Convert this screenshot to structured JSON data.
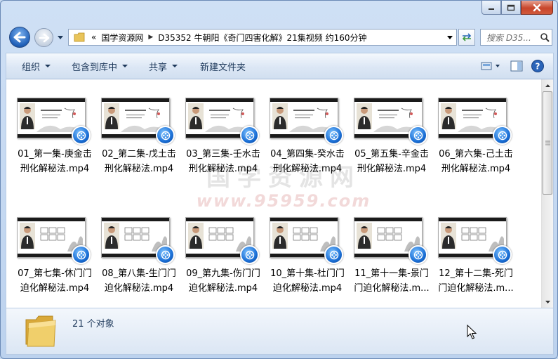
{
  "window": {
    "caption": {
      "minimize_icon": "minimize-icon",
      "maximize_icon": "maximize-icon",
      "close_icon": "close-icon"
    }
  },
  "address_bar": {
    "overflow": "«",
    "crumbs": [
      "国学资源网",
      "D35352 牛朝阳《奇门四害化解》21集视频 约160分钟"
    ]
  },
  "search": {
    "placeholder": "搜索 D35..."
  },
  "toolbar": {
    "organize": "组织",
    "include_in_library": "包含到库中",
    "share": "共享",
    "new_folder": "新建文件夹"
  },
  "watermark": {
    "title": "国学资源网",
    "url": "www.95959.com"
  },
  "files": [
    {
      "line1": "01_第一集-庚金击",
      "line2": "刑化解秘法.mp4"
    },
    {
      "line1": "02_第二集-戊土击",
      "line2": "刑化解秘法.mp4"
    },
    {
      "line1": "03_第三集-壬水击",
      "line2": "刑化解秘法.mp4"
    },
    {
      "line1": "04_第四集-癸水击",
      "line2": "刑化解秘法.mp4"
    },
    {
      "line1": "05_第五集-辛金击",
      "line2": "刑化解秘法.mp4"
    },
    {
      "line1": "06_第六集-己土击",
      "line2": "刑化解秘法.mp4"
    },
    {
      "line1": "07_第七集-休门门",
      "line2": "迫化解秘法.mp4"
    },
    {
      "line1": "08_第八集-生门门",
      "line2": "迫化解秘法.mp4"
    },
    {
      "line1": "09_第九集-伤门门",
      "line2": "迫化解秘法.mp4"
    },
    {
      "line1": "10_第十集-杜门门",
      "line2": "迫化解秘法.mp4"
    },
    {
      "line1": "11_第十一集-景门",
      "line2": "门迫化解秘法.m..."
    },
    {
      "line1": "12_第十二集-死门",
      "line2": "门迫化解秘法.m..."
    }
  ],
  "status": {
    "count": "21 个对象"
  },
  "colors": {
    "accent": "#1e395b",
    "play_blue": "#1a6fd6",
    "close_red": "#c8452b"
  }
}
